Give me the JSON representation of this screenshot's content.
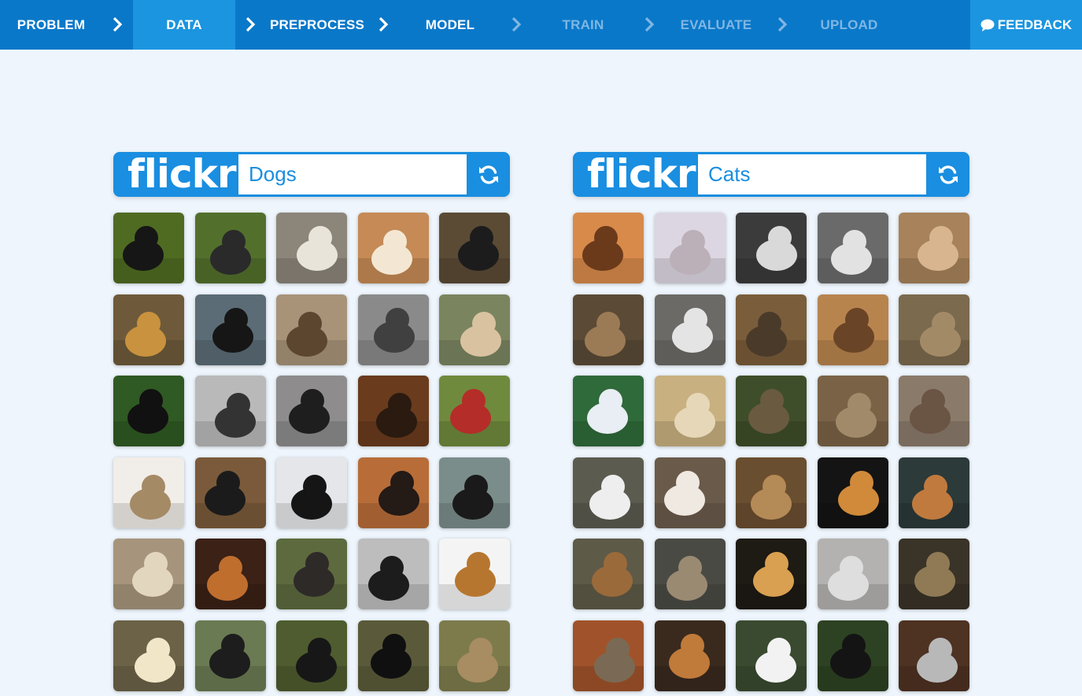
{
  "nav": {
    "steps": [
      {
        "label": "PROBLEM",
        "state": "done"
      },
      {
        "label": "DATA",
        "state": "active"
      },
      {
        "label": "PREPROCESS",
        "state": "done"
      },
      {
        "label": "MODEL",
        "state": "done"
      },
      {
        "label": "TRAIN",
        "state": "disabled"
      },
      {
        "label": "EVALUATE",
        "state": "disabled"
      },
      {
        "label": "UPLOAD",
        "state": "disabled"
      }
    ],
    "feedback_label": "FEEDBACK"
  },
  "panels": [
    {
      "logo_text": "flickr",
      "query": "Dogs",
      "refresh_icon": "refresh-icon",
      "thumbnails": [
        {
          "bg": "#4f6b22",
          "fg": "#161616"
        },
        {
          "bg": "#52702c",
          "fg": "#2a2a2a"
        },
        {
          "bg": "#8b857a",
          "fg": "#e8e4da"
        },
        {
          "bg": "#c58a55",
          "fg": "#f3e7d4"
        },
        {
          "bg": "#5b4b35",
          "fg": "#1c1c1c"
        },
        {
          "bg": "#6e5a3a",
          "fg": "#c9923e"
        },
        {
          "bg": "#5b6c76",
          "fg": "#161616"
        },
        {
          "bg": "#a89378",
          "fg": "#5c4630"
        },
        {
          "bg": "#8a8a8a",
          "fg": "#404040"
        },
        {
          "bg": "#7a8560",
          "fg": "#d9c2a0"
        },
        {
          "bg": "#2f5a23",
          "fg": "#111111"
        },
        {
          "bg": "#b9b9b9",
          "fg": "#333333"
        },
        {
          "bg": "#8e8c8c",
          "fg": "#1e1e1e"
        },
        {
          "bg": "#6a3b1d",
          "fg": "#2a1a10"
        },
        {
          "bg": "#6f8a3c",
          "fg": "#b52d28"
        },
        {
          "bg": "#f1ede8",
          "fg": "#a58a66"
        },
        {
          "bg": "#7a5a3a",
          "fg": "#1b1b1b"
        },
        {
          "bg": "#e5e6e9",
          "fg": "#151515"
        },
        {
          "bg": "#b86d38",
          "fg": "#241a16"
        },
        {
          "bg": "#7a8d8a",
          "fg": "#1a1a1a"
        },
        {
          "bg": "#a6957c",
          "fg": "#e2d6bf"
        },
        {
          "bg": "#3b2116",
          "fg": "#c06e2e"
        },
        {
          "bg": "#5d6a3e",
          "fg": "#2e2a28"
        },
        {
          "bg": "#bdbdbd",
          "fg": "#1c1c1c"
        },
        {
          "bg": "#f4f4f4",
          "fg": "#b7762f"
        },
        {
          "bg": "#6b6247",
          "fg": "#f2e6c9"
        },
        {
          "bg": "#6a7a52",
          "fg": "#1d1d1d"
        },
        {
          "bg": "#4f5c2f",
          "fg": "#171717"
        },
        {
          "bg": "#5a5a3a",
          "fg": "#101010"
        },
        {
          "bg": "#7d7b4c",
          "fg": "#a88c62"
        }
      ]
    },
    {
      "logo_text": "flickr",
      "query": "Cats",
      "refresh_icon": "refresh-icon",
      "thumbnails": [
        {
          "bg": "#d88a4a",
          "fg": "#6b3a1a"
        },
        {
          "bg": "#dcd6e2",
          "fg": "#bbb0b8"
        },
        {
          "bg": "#3b3b3b",
          "fg": "#d9d9d9"
        },
        {
          "bg": "#6a6a6a",
          "fg": "#e2e2e2"
        },
        {
          "bg": "#a7825a",
          "fg": "#d8b58f"
        },
        {
          "bg": "#5a4a36",
          "fg": "#9b7b55"
        },
        {
          "bg": "#6c6a66",
          "fg": "#e4e4e4"
        },
        {
          "bg": "#7a5d3a",
          "fg": "#4a3a2a"
        },
        {
          "bg": "#b8844e",
          "fg": "#6a4426"
        },
        {
          "bg": "#7b6a4e",
          "fg": "#a38a66"
        },
        {
          "bg": "#2f6a3a",
          "fg": "#e8eef3"
        },
        {
          "bg": "#c8b080",
          "fg": "#e6d7b8"
        },
        {
          "bg": "#3e4e2a",
          "fg": "#6a5a40"
        },
        {
          "bg": "#7a6246",
          "fg": "#a08a6a"
        },
        {
          "bg": "#8a7a6a",
          "fg": "#6a5444"
        },
        {
          "bg": "#5b5b4f",
          "fg": "#eeeeee"
        },
        {
          "bg": "#6a5a4a",
          "fg": "#efe9e2"
        },
        {
          "bg": "#6a4e30",
          "fg": "#b48a56"
        },
        {
          "bg": "#141414",
          "fg": "#d08a3a"
        },
        {
          "bg": "#2c3a3a",
          "fg": "#c07a3e"
        },
        {
          "bg": "#5e5a48",
          "fg": "#9a6a3a"
        },
        {
          "bg": "#4a4a44",
          "fg": "#9a8a72"
        },
        {
          "bg": "#1e1a14",
          "fg": "#d8a050"
        },
        {
          "bg": "#b4b2b0",
          "fg": "#dedede"
        },
        {
          "bg": "#3a3328",
          "fg": "#8f7a55"
        },
        {
          "bg": "#a0532a",
          "fg": "#7a6a55"
        },
        {
          "bg": "#3a2a1e",
          "fg": "#c07a3a"
        },
        {
          "bg": "#3a4a30",
          "fg": "#f2f2f2"
        },
        {
          "bg": "#2d4222",
          "fg": "#141414"
        },
        {
          "bg": "#4e3222",
          "fg": "#b8b8b8"
        }
      ]
    }
  ]
}
